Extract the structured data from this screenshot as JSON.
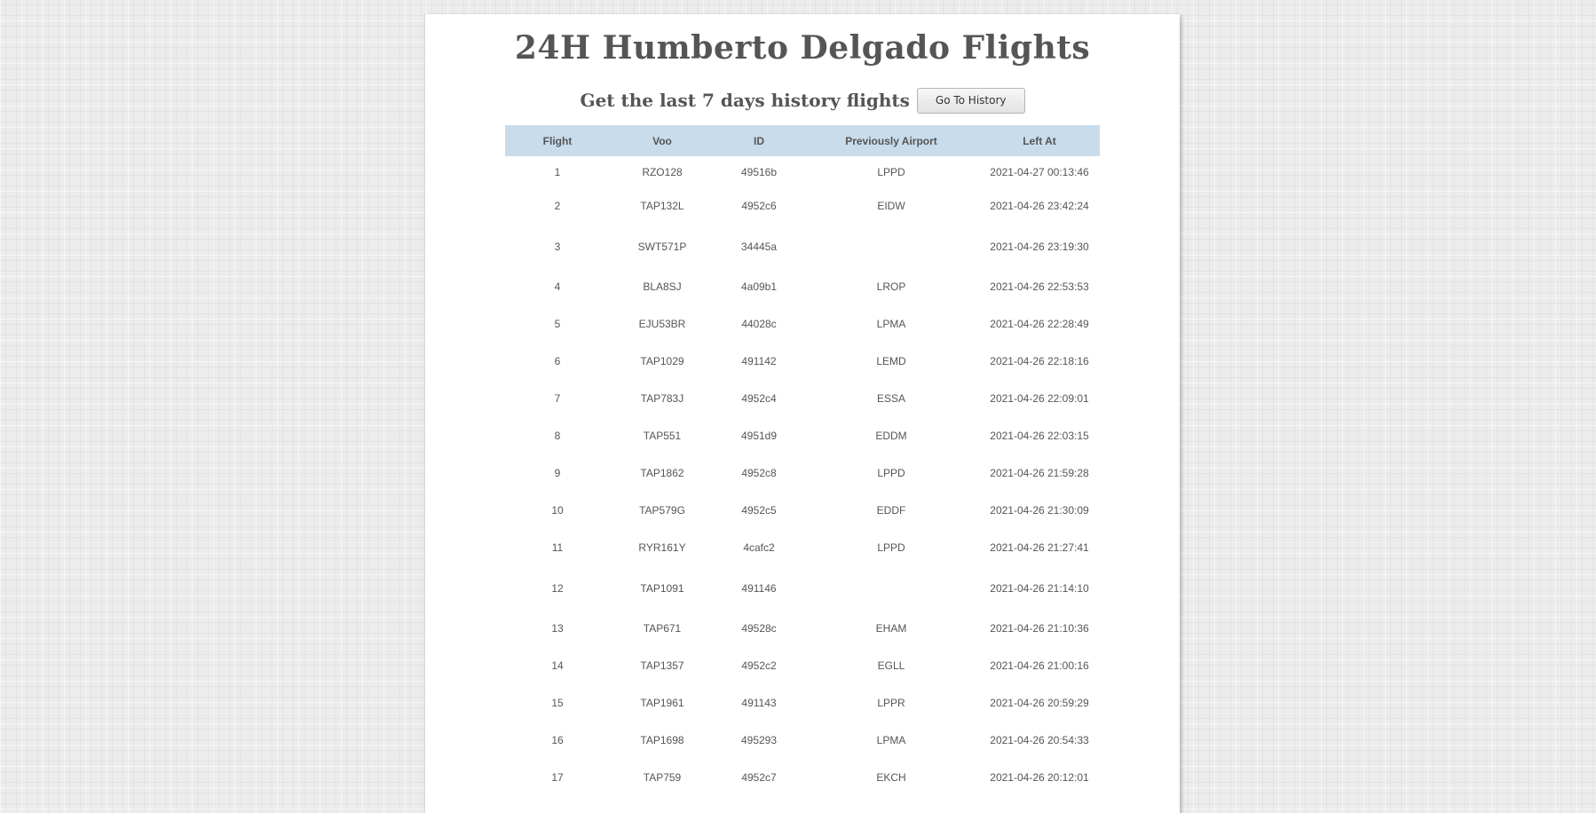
{
  "header": {
    "title": "24H Humberto Delgado Flights",
    "subtitle": "Get the last 7 days history flights",
    "history_button": "Go To History"
  },
  "table": {
    "columns": [
      "Flight",
      "Voo",
      "ID",
      "Previously Airport",
      "Left At"
    ],
    "rows": [
      [
        "1",
        "RZO128",
        "49516b",
        "LPPD",
        "2021-04-27 00:13:46"
      ],
      [
        "2",
        "TAP132L",
        "4952c6",
        "EIDW",
        "2021-04-26 23:42:24"
      ],
      [
        "3",
        "SWT571P",
        "34445a",
        "",
        "2021-04-26 23:19:30"
      ],
      [
        "4",
        "BLA8SJ",
        "4a09b1",
        "LROP",
        "2021-04-26 22:53:53"
      ],
      [
        "5",
        "EJU53BR",
        "44028c",
        "LPMA",
        "2021-04-26 22:28:49"
      ],
      [
        "6",
        "TAP1029",
        "491142",
        "LEMD",
        "2021-04-26 22:18:16"
      ],
      [
        "7",
        "TAP783J",
        "4952c4",
        "ESSA",
        "2021-04-26 22:09:01"
      ],
      [
        "8",
        "TAP551",
        "4951d9",
        "EDDM",
        "2021-04-26 22:03:15"
      ],
      [
        "9",
        "TAP1862",
        "4952c8",
        "LPPD",
        "2021-04-26 21:59:28"
      ],
      [
        "10",
        "TAP579G",
        "4952c5",
        "EDDF",
        "2021-04-26 21:30:09"
      ],
      [
        "11",
        "RYR161Y",
        "4cafc2",
        "LPPD",
        "2021-04-26 21:27:41"
      ],
      [
        "12",
        "TAP1091",
        "491146",
        "",
        "2021-04-26 21:14:10"
      ],
      [
        "13",
        "TAP671",
        "49528c",
        "EHAM",
        "2021-04-26 21:10:36"
      ],
      [
        "14",
        "TAP1357",
        "4952c2",
        "EGLL",
        "2021-04-26 21:00:16"
      ],
      [
        "15",
        "TAP1961",
        "491143",
        "LPPR",
        "2021-04-26 20:59:29"
      ],
      [
        "16",
        "TAP1698",
        "495293",
        "LPMA",
        "2021-04-26 20:54:33"
      ],
      [
        "17",
        "TAP759",
        "4952c7",
        "EKCH",
        "2021-04-26 20:12:01"
      ]
    ]
  }
}
